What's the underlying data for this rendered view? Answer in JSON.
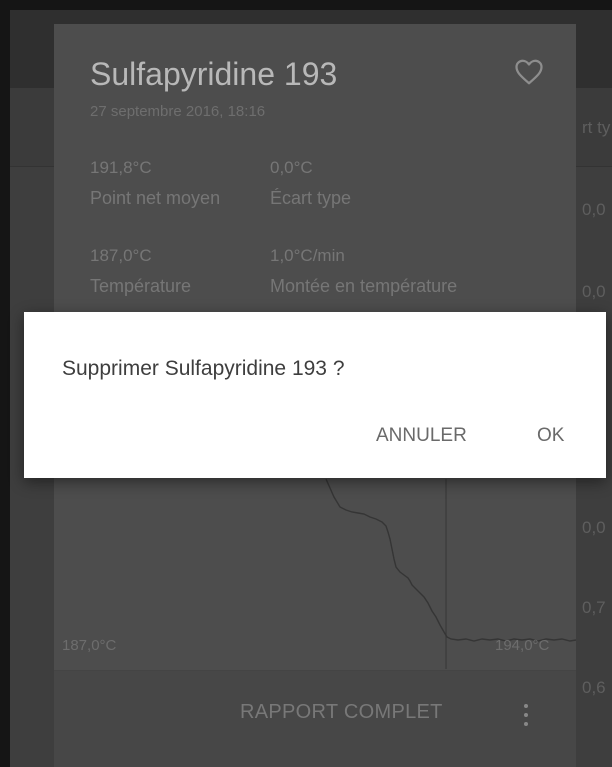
{
  "background": {
    "column_fragments": [
      "rt ty",
      "0,0",
      "0,0",
      "0,0",
      "0,7",
      "0,6"
    ]
  },
  "card": {
    "title": "Sulfapyridine 193",
    "date": "27 septembre 2016, 18:16",
    "favorite_icon": "heart-outline-icon",
    "stats": [
      {
        "value": "191,8°C",
        "label": "Point net moyen"
      },
      {
        "value": "0,0°C",
        "label": "Écart type"
      },
      {
        "value": "187,0°C",
        "label": "Température"
      },
      {
        "value": "1,0°C/min",
        "label": "Montée en température"
      }
    ],
    "chart": {
      "x_min_label": "187,0°C",
      "x_max_label": "194,0°C"
    },
    "actions": {
      "report_label": "RAPPORT COMPLET",
      "more_icon": "more-vertical-icon"
    }
  },
  "dialog": {
    "message": "Supprimer Sulfapyridine 193 ?",
    "cancel_label": "ANNULER",
    "ok_label": "OK"
  }
}
